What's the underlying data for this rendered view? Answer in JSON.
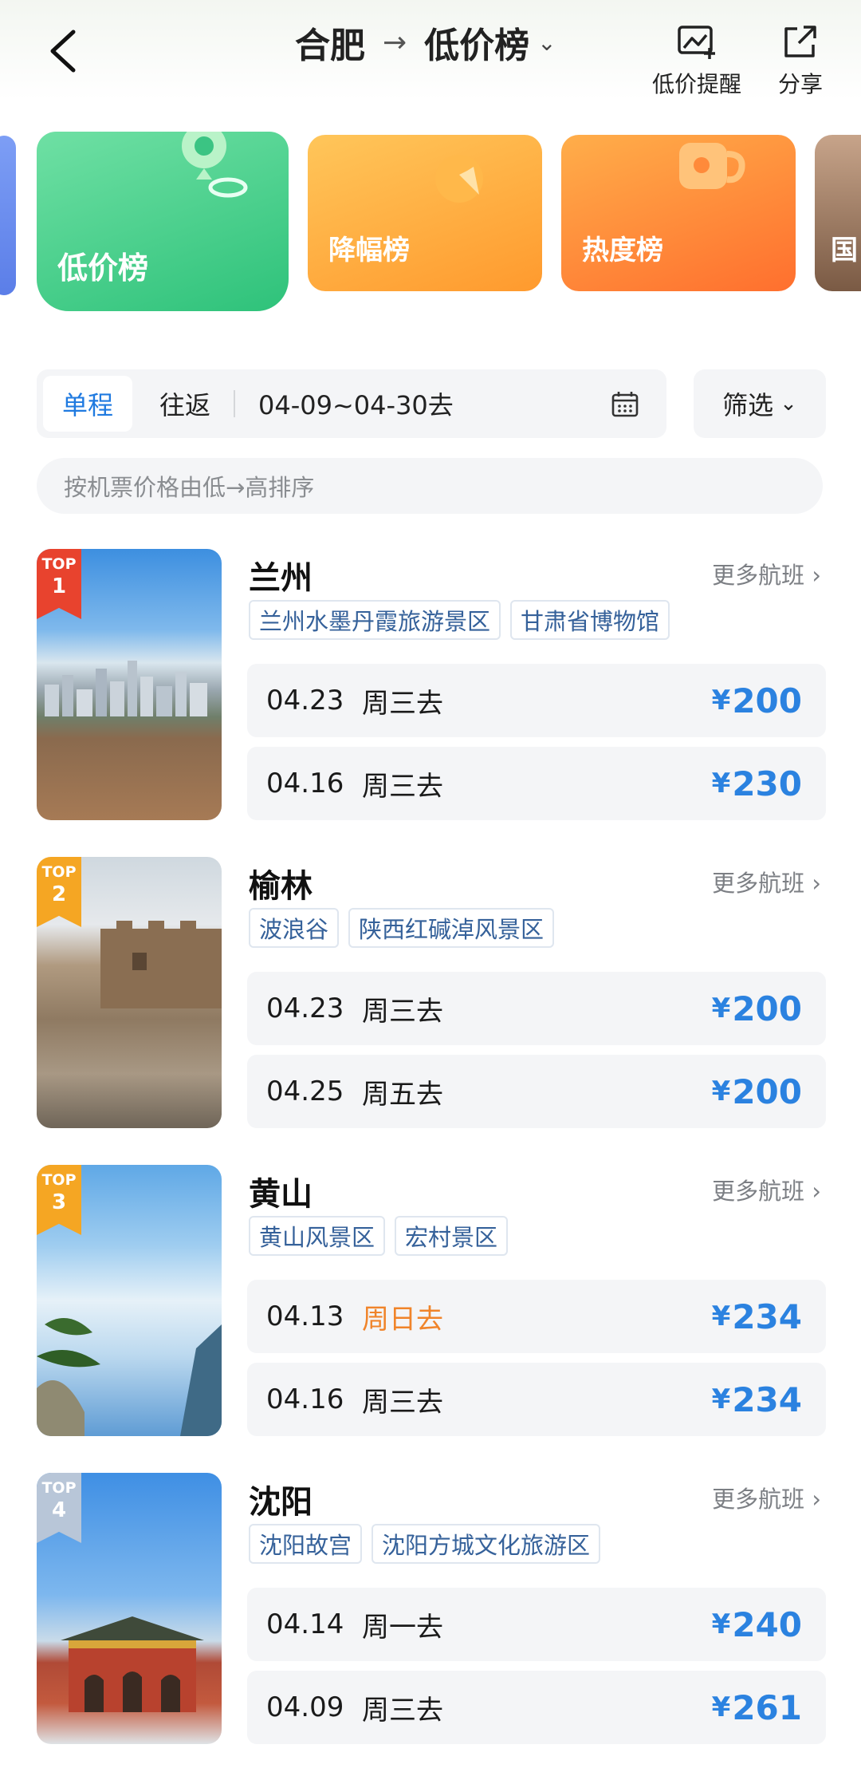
{
  "header": {
    "origin": "合肥",
    "route_arrow": "→",
    "list_title": "低价榜",
    "alert_label": "低价提醒",
    "share_label": "分享"
  },
  "categories": [
    {
      "label": "低价榜",
      "active": true
    },
    {
      "label": "降幅榜",
      "active": false
    },
    {
      "label": "热度榜",
      "active": false
    },
    {
      "label": "国",
      "active": false
    }
  ],
  "filter": {
    "one_way": "单程",
    "round_trip": "往返",
    "date_range": "04-09~04-30去",
    "filter_label": "筛选",
    "filter_chevron": "⌄"
  },
  "sort_hint": "按机票价格由低→高排序",
  "destinations": [
    {
      "rank_top": "TOP",
      "rank": "1",
      "name": "兰州",
      "more": "更多航班 ›",
      "tags": [
        "兰州水墨丹霞旅游景区",
        "甘肃省博物馆"
      ],
      "flights": [
        {
          "date": "04.23",
          "dow": "周三去",
          "currency": "¥",
          "price": "200"
        },
        {
          "date": "04.16",
          "dow": "周三去",
          "currency": "¥",
          "price": "230"
        }
      ]
    },
    {
      "rank_top": "TOP",
      "rank": "2",
      "name": "榆林",
      "more": "更多航班 ›",
      "tags": [
        "波浪谷",
        "陕西红碱淖风景区"
      ],
      "flights": [
        {
          "date": "04.23",
          "dow": "周三去",
          "currency": "¥",
          "price": "200"
        },
        {
          "date": "04.25",
          "dow": "周五去",
          "currency": "¥",
          "price": "200"
        }
      ]
    },
    {
      "rank_top": "TOP",
      "rank": "3",
      "name": "黄山",
      "more": "更多航班 ›",
      "tags": [
        "黄山风景区",
        "宏村景区"
      ],
      "flights": [
        {
          "date": "04.13",
          "dow": "周日去",
          "currency": "¥",
          "price": "234"
        },
        {
          "date": "04.16",
          "dow": "周三去",
          "currency": "¥",
          "price": "234"
        }
      ]
    },
    {
      "rank_top": "TOP",
      "rank": "4",
      "name": "沈阳",
      "more": "更多航班 ›",
      "tags": [
        "沈阳故宫",
        "沈阳方城文化旅游区"
      ],
      "flights": [
        {
          "date": "04.14",
          "dow": "周一去",
          "currency": "¥",
          "price": "240"
        },
        {
          "date": "04.09",
          "dow": "周三去",
          "currency": "¥",
          "price": "261"
        }
      ]
    }
  ],
  "colors": {
    "accent_blue": "#2b82e0",
    "weekend_orange": "#f0842a",
    "rank1": "#e8432e",
    "rank2": "#f5a623",
    "rank3": "#f5a623",
    "rank4": "#b8c6d8"
  }
}
